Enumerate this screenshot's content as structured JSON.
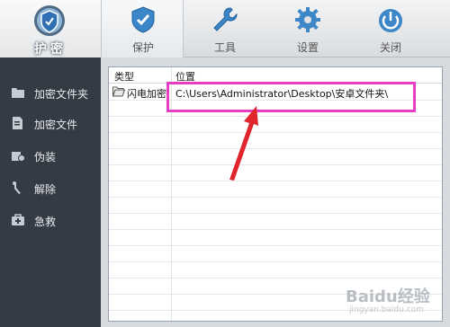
{
  "logo": {
    "label": "护密",
    "icon": "shield-lock-icon"
  },
  "tabs": [
    {
      "label": "保护",
      "icon": "shield-check-icon",
      "active": true
    },
    {
      "label": "工具",
      "icon": "wrench-icon",
      "active": false
    },
    {
      "label": "设置",
      "icon": "gear-icon",
      "active": false
    },
    {
      "label": "关闭",
      "icon": "power-icon",
      "active": false
    }
  ],
  "sidebar": {
    "items": [
      {
        "label": "加密文件夹",
        "icon": "folder-lock-icon"
      },
      {
        "label": "加密文件",
        "icon": "file-lock-icon"
      },
      {
        "label": "伪装",
        "icon": "disguise-icon"
      },
      {
        "label": "解除",
        "icon": "unlock-icon"
      },
      {
        "label": "急救",
        "icon": "first-aid-icon"
      }
    ]
  },
  "table": {
    "columns": [
      "类型",
      "位置"
    ],
    "rows": [
      {
        "type": "闪电加密",
        "path": "C:\\Users\\Administrator\\Desktop\\安卓文件夹\\"
      }
    ]
  },
  "annotation": {
    "highlight_color": "#e53dc3",
    "arrow_color": "#e0262c"
  },
  "watermark": {
    "text": "Baidu经验",
    "subtext": "jingyan.baidu.com"
  }
}
